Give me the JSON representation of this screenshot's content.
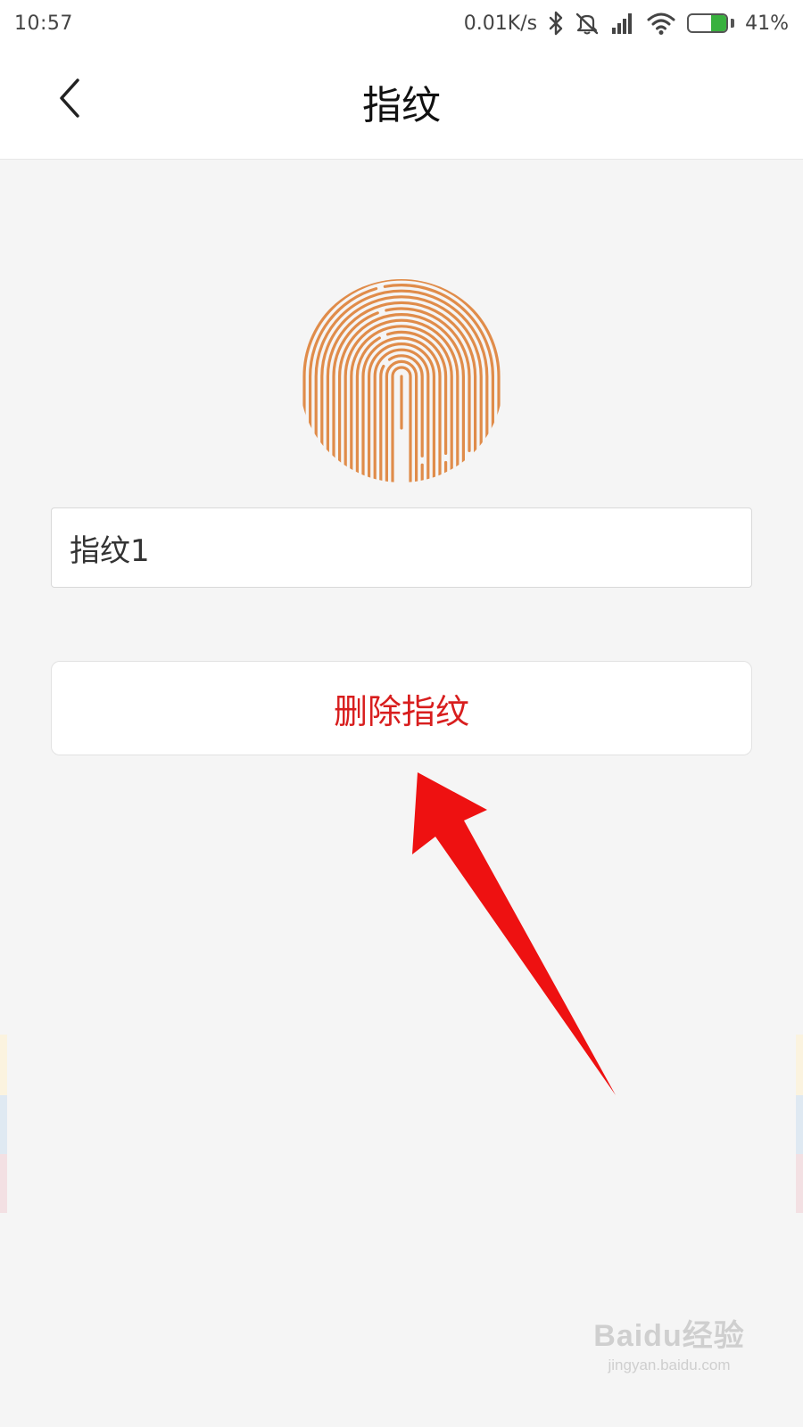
{
  "status_bar": {
    "time": "10:57",
    "net_speed": "0.01K/s",
    "battery_percent": "41%",
    "battery_level": 0.41,
    "icons": [
      "bluetooth-icon",
      "mute-icon",
      "signal-icon",
      "wifi-icon",
      "battery-icon"
    ]
  },
  "header": {
    "title": "指纹",
    "back_icon": "chevron-left-icon"
  },
  "fingerprint": {
    "icon": "fingerprint-icon",
    "color": "#e08c4a"
  },
  "name_field": {
    "value": "指纹1"
  },
  "actions": {
    "delete_label": "删除指纹",
    "delete_color": "#d81e1e"
  },
  "annotation": {
    "icon": "red-arrow-icon",
    "color": "#ee1111"
  },
  "watermark": {
    "logo": "Baidu经验",
    "url": "jingyan.baidu.com"
  }
}
